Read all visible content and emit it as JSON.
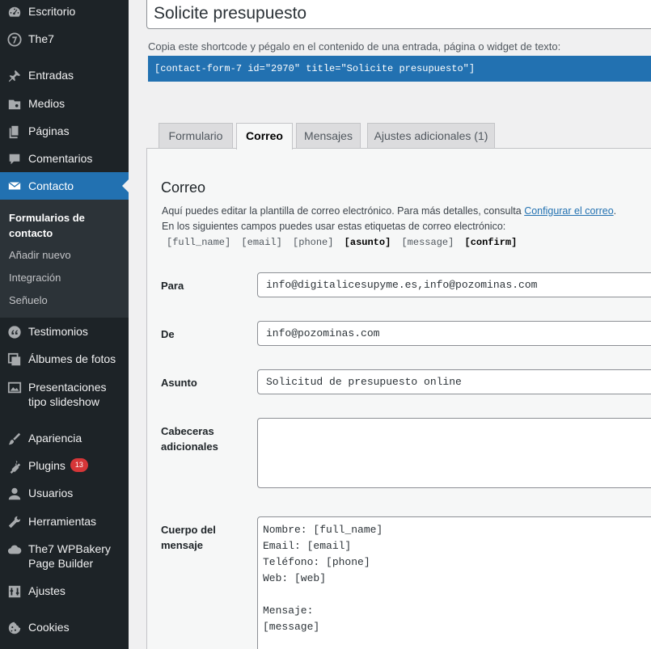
{
  "sidebar": {
    "items": [
      {
        "label": "Escritorio",
        "icon": "dashboard-icon"
      },
      {
        "label": "The7",
        "icon": "the7-icon"
      },
      {
        "label": "Entradas",
        "icon": "pin-icon"
      },
      {
        "label": "Medios",
        "icon": "media-icon"
      },
      {
        "label": "Páginas",
        "icon": "pages-icon"
      },
      {
        "label": "Comentarios",
        "icon": "comments-icon"
      },
      {
        "label": "Contacto",
        "icon": "email-icon"
      },
      {
        "label": "Testimonios",
        "icon": "quote-icon"
      },
      {
        "label": "Álbumes de fotos",
        "icon": "gallery-icon"
      },
      {
        "label": "Presentaciones tipo slideshow",
        "icon": "slideshow-icon"
      },
      {
        "label": "Apariencia",
        "icon": "brush-icon"
      },
      {
        "label": "Plugins",
        "icon": "plugin-icon",
        "badge": "13"
      },
      {
        "label": "Usuarios",
        "icon": "user-icon"
      },
      {
        "label": "Herramientas",
        "icon": "wrench-icon"
      },
      {
        "label": "The7 WPBakery Page Builder",
        "icon": "cloud-icon"
      },
      {
        "label": "Ajustes",
        "icon": "settings-icon"
      },
      {
        "label": "Cookies",
        "icon": "cookie-icon"
      }
    ],
    "submenu": [
      {
        "label": "Formularios de contacto"
      },
      {
        "label": "Añadir nuevo"
      },
      {
        "label": "Integración"
      },
      {
        "label": "Señuelo"
      }
    ]
  },
  "form": {
    "title": "Solicite presupuesto",
    "shortcode_label": "Copia este shortcode y pégalo en el contenido de una entrada, página o widget de texto:",
    "shortcode": "[contact-form-7 id=\"2970\" title=\"Solicite presupuesto\"]"
  },
  "tabs": [
    {
      "label": "Formulario"
    },
    {
      "label": "Correo"
    },
    {
      "label": "Mensajes"
    },
    {
      "label": "Ajustes adicionales (1)"
    }
  ],
  "mail": {
    "heading": "Correo",
    "help_text": "Aquí puedes editar la plantilla de correo electrónico. Para más detalles, consulta",
    "help_link": "Configurar el correo",
    "help_end": ".",
    "tags_intro": "En los siguientes campos puedes usar estas etiquetas de correo electrónico:",
    "tags": [
      {
        "tag": "[full_name]",
        "used": false
      },
      {
        "tag": "[email]",
        "used": false
      },
      {
        "tag": "[phone]",
        "used": false
      },
      {
        "tag": "[asunto]",
        "used": true
      },
      {
        "tag": "[message]",
        "used": false
      },
      {
        "tag": "[confirm]",
        "used": true
      }
    ],
    "to_label": "Para",
    "to_value": "info@digitalicesupyme.es,info@pozominas.com",
    "from_label": "De",
    "from_value": "info@pozominas.com",
    "subject_label": "Asunto",
    "subject_value": "Solicitud de presupuesto online",
    "headers_label_1": "Cabeceras",
    "headers_label_2": "adicionales",
    "headers_value": "",
    "body_label_1": "Cuerpo del",
    "body_label_2": "mensaje",
    "body_value": "Nombre: [full_name]\nEmail: [email]\nTeléfono: [phone]\nWeb: [web]\n\nMensaje:\n[message]"
  }
}
